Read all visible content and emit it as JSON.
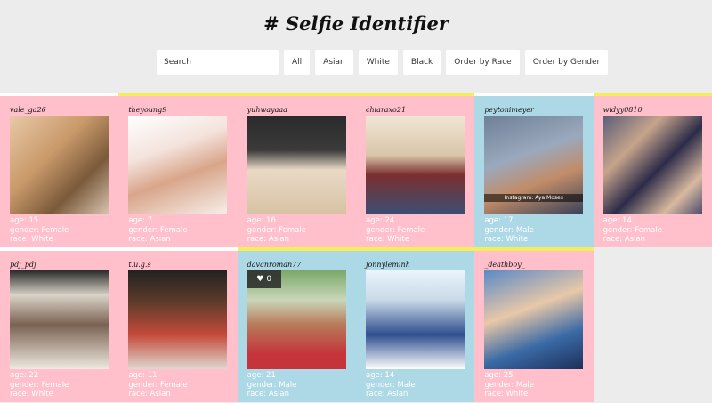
{
  "app": {
    "title": "# Selfie Identifier"
  },
  "search": {
    "placeholder": "Search"
  },
  "filters": [
    "All",
    "Asian",
    "White",
    "Black",
    "Order by Race",
    "Order by Gender"
  ],
  "labels": {
    "age": "age: ",
    "gender": "gender: ",
    "race": "race: "
  },
  "colors": {
    "pink": "#ffc0cb",
    "blue": "#add8e6",
    "accent_yellow": "#f5ee5b",
    "background": "#ececec"
  },
  "cards": [
    {
      "username": "vale_ga26",
      "age": "15",
      "gender": "Female",
      "race": "White",
      "color": "pink",
      "accent": "white"
    },
    {
      "username": "theyoung9",
      "age": "7",
      "gender": "Female",
      "race": "Asian",
      "color": "pink",
      "accent": "yellow"
    },
    {
      "username": "yuhwayaaa",
      "age": "16",
      "gender": "Female",
      "race": "Asian",
      "color": "pink",
      "accent": "yellow"
    },
    {
      "username": "chiaraxo21",
      "age": "24",
      "gender": "Female",
      "race": "White",
      "color": "pink",
      "accent": "yellow"
    },
    {
      "username": "peytonimeyer",
      "age": "17",
      "gender": "Male",
      "race": "White",
      "color": "blue",
      "accent": "white",
      "overlay": "Instagram: Aya Moses"
    },
    {
      "username": "widyy0810",
      "age": "14",
      "gender": "Female",
      "race": "Asian",
      "color": "pink",
      "accent": "yellow"
    },
    {
      "username": "pdj_pdj",
      "age": "22",
      "gender": "Female",
      "race": "White",
      "color": "pink",
      "accent": "white"
    },
    {
      "username": "t.u.g.s",
      "age": "11",
      "gender": "Female",
      "race": "Asian",
      "color": "pink",
      "accent": "white"
    },
    {
      "username": "davanroman77",
      "age": "21",
      "gender": "Male",
      "race": "Asian",
      "color": "blue",
      "accent": "yellow",
      "likes": "0"
    },
    {
      "username": "jonnyleminh",
      "age": "14",
      "gender": "Male",
      "race": "Asian",
      "color": "blue",
      "accent": "yellow"
    },
    {
      "username": "_deathboy_",
      "age": "25",
      "gender": "Male",
      "race": "White",
      "color": "pink",
      "accent": "yellow"
    }
  ]
}
